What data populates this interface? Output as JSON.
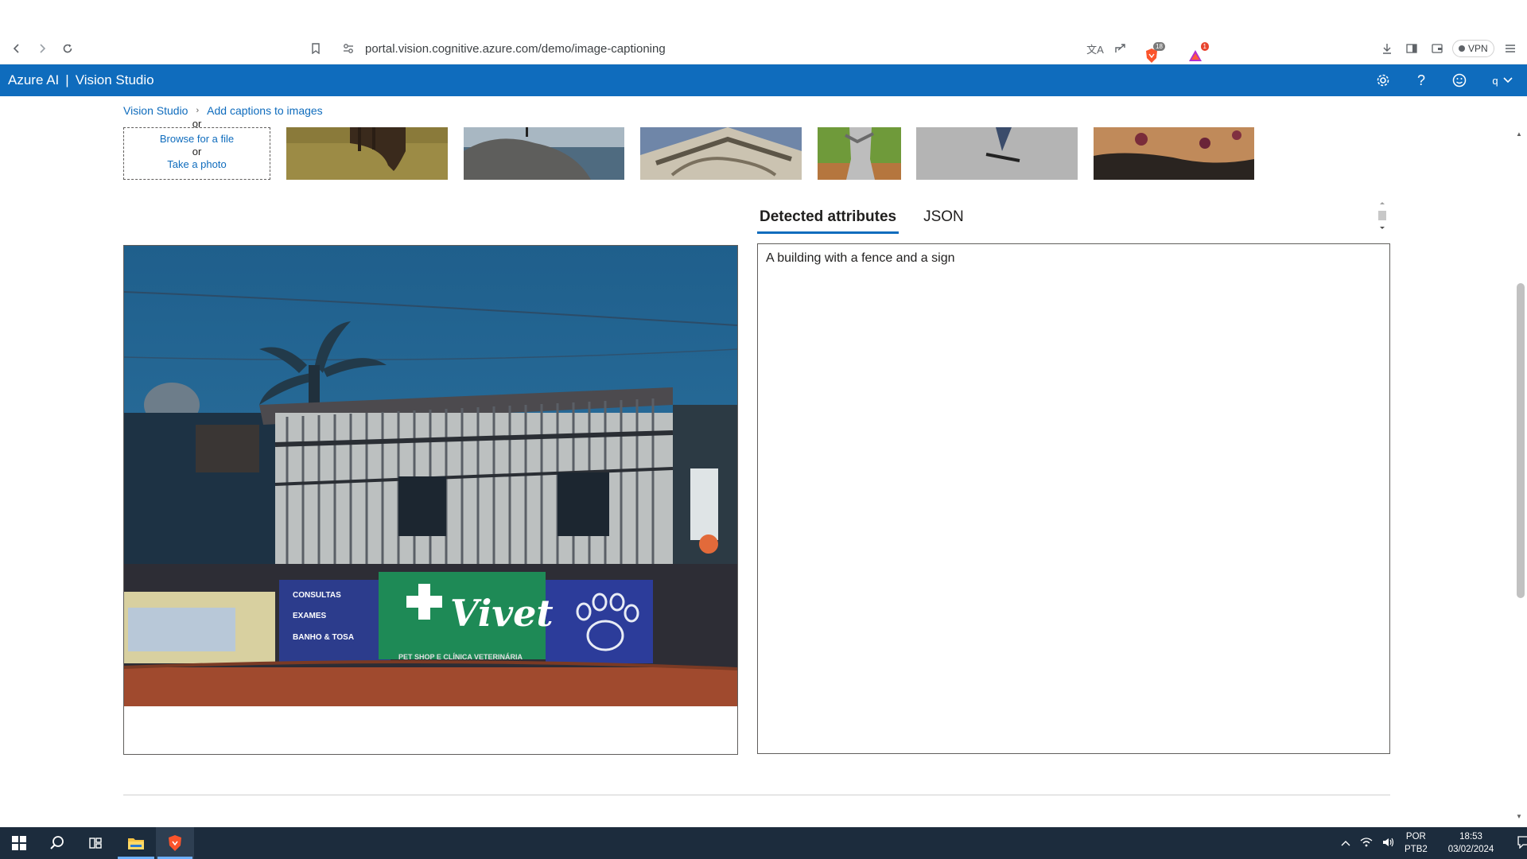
{
  "browser": {
    "url": "portal.vision.cognitive.azure.com/demo/image-captioning",
    "ext_count_shield": "18",
    "ext_count_alert": "1",
    "vpn_label": "VPN"
  },
  "header": {
    "brand": "Azure AI",
    "separator": "|",
    "product": "Vision Studio",
    "avatar_initial": "q"
  },
  "breadcrumb": {
    "items": [
      "Vision Studio",
      "Add captions to images"
    ]
  },
  "upload": {
    "or_top": "or",
    "browse_label": "Browse for a file",
    "or_label": "or",
    "photo_label": "Take a photo"
  },
  "tabs": [
    {
      "label": "Detected attributes",
      "active": true
    },
    {
      "label": "JSON",
      "active": false
    }
  ],
  "result": {
    "caption": "A building with a fence and a sign"
  },
  "image": {
    "sign_items": [
      "CONSULTAS",
      "EXAMES",
      "BANHO & TOSA"
    ],
    "sign_brand": "Vivet",
    "sign_footer": "PET SHOP E CLÍNICA VETERINÁRIA"
  },
  "taskbar": {
    "lang_line1": "POR",
    "lang_line2": "PTB2",
    "time": "18:53",
    "date": "03/02/2024"
  },
  "colors": {
    "azure_blue": "#0f6cbd",
    "taskbar": "#1c2c3d"
  }
}
